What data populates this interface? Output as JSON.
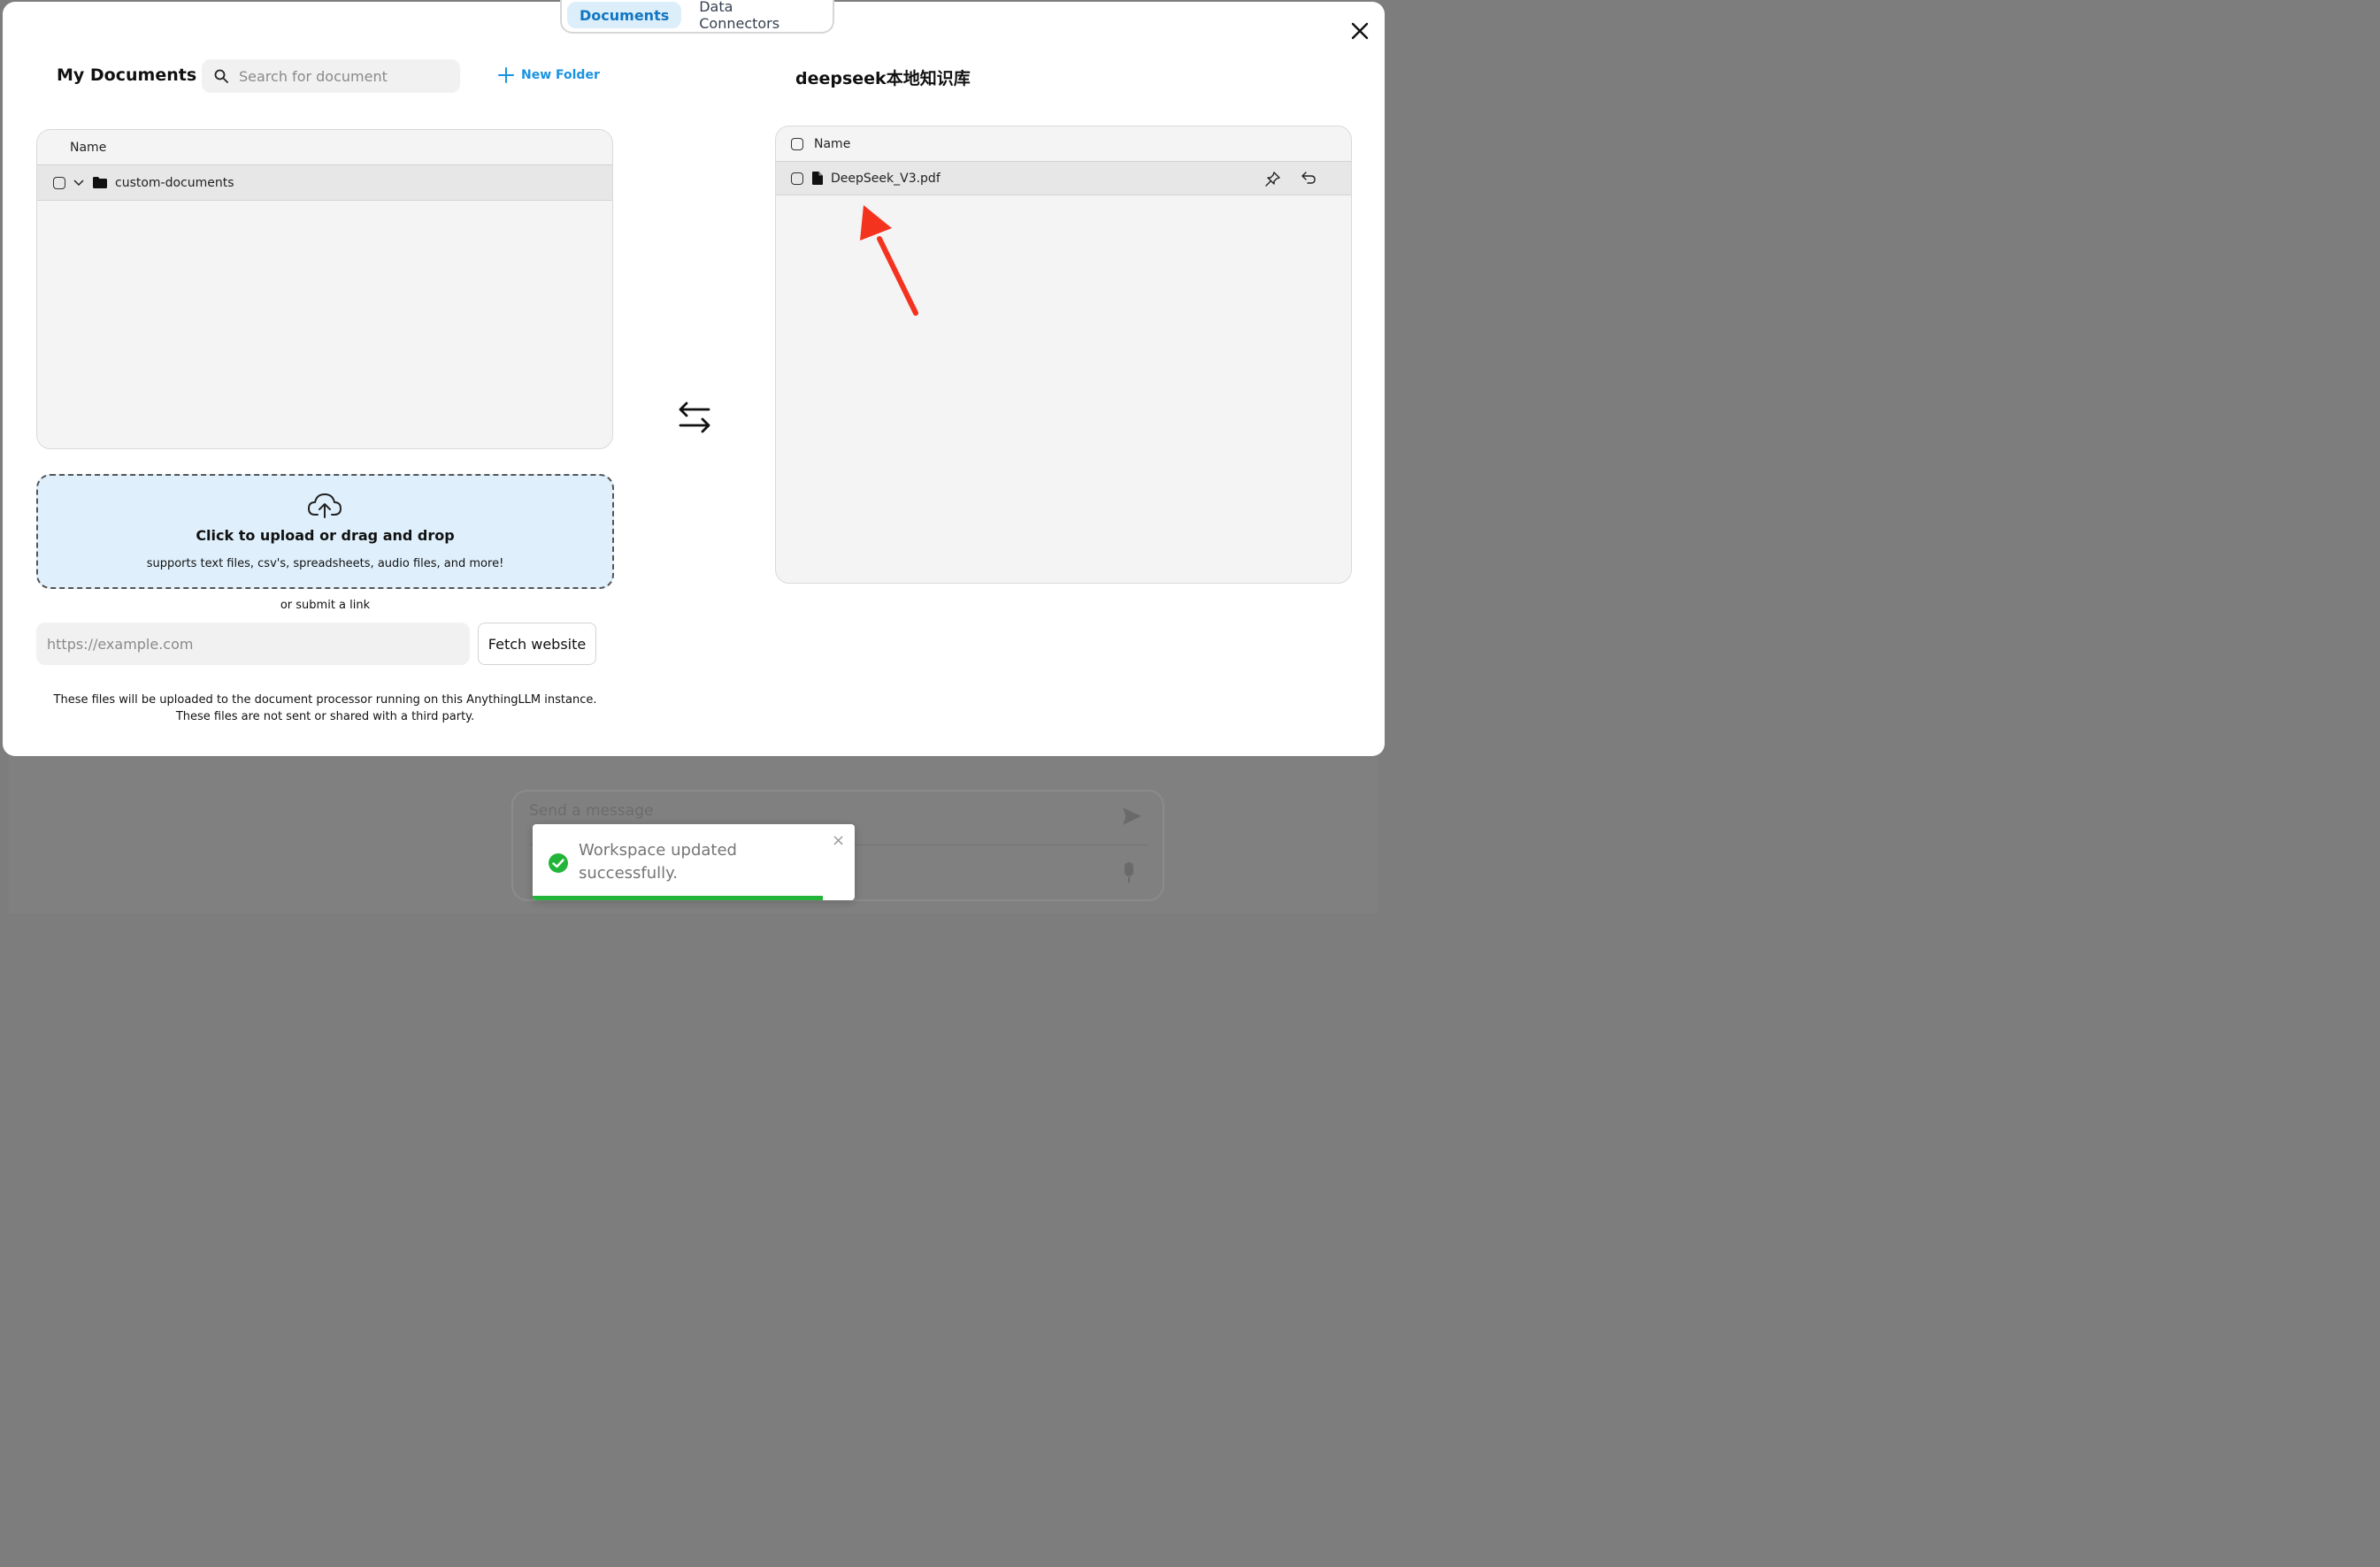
{
  "tabs": [
    {
      "label": "Documents",
      "active": true
    },
    {
      "label": "Data Connectors",
      "active": false
    }
  ],
  "left": {
    "title": "My Documents",
    "search_placeholder": "Search for document",
    "new_folder_label": "New Folder",
    "column_name": "Name",
    "rows": [
      {
        "name": "custom-documents",
        "type": "folder",
        "expanded": true
      }
    ]
  },
  "right": {
    "title": "deepseek本地知识库",
    "column_name": "Name",
    "rows": [
      {
        "name": "DeepSeek_V3.pdf",
        "type": "file"
      }
    ]
  },
  "upload": {
    "title": "Click to upload or drag and drop",
    "subtitle": "supports text files, csv's, spreadsheets, audio files, and more!",
    "or_link": "or submit a link",
    "url_placeholder": "https://example.com",
    "fetch_label": "Fetch website",
    "note_line1": "These files will be uploaded to the document processor running on this AnythingLLM instance.",
    "note_line2": "These files are not sent or shared with a third party."
  },
  "background": {
    "composer_placeholder": "Send a message"
  },
  "toast": {
    "message": "Workspace updated successfully.",
    "close_glyph": "×",
    "progress_fraction": 0.9
  },
  "colors": {
    "accent": "#1993e0",
    "active_tab_bg": "#dbeefa",
    "dropzone_bg": "#dff0fc",
    "success": "#22b53a",
    "annotation_arrow": "#f4331f"
  }
}
